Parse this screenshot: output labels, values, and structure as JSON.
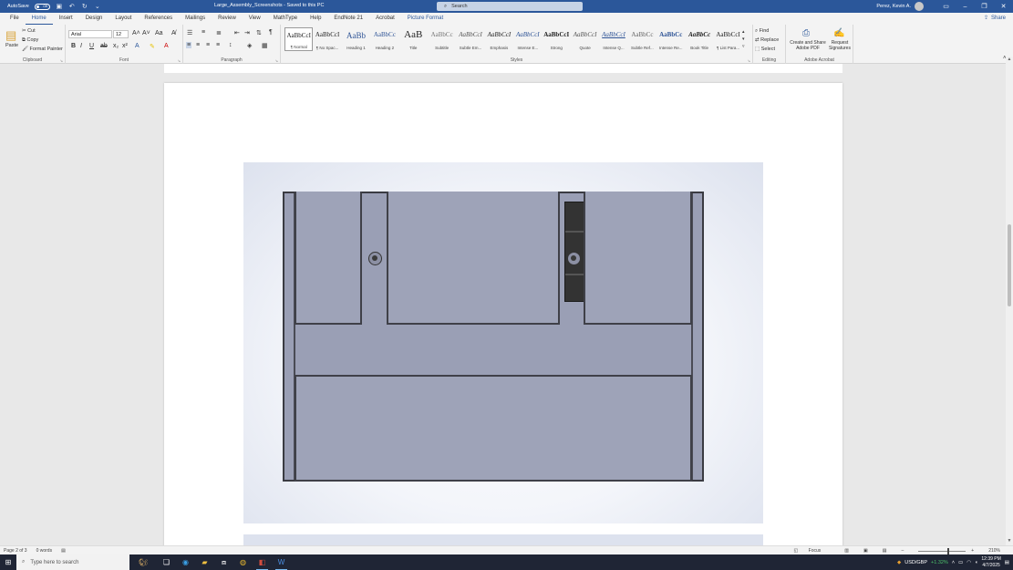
{
  "titlebar": {
    "autosave_label": "AutoSave",
    "autosave_state": "Off",
    "doc_title": "Large_Assembly_Screenshots  -  Saved to this PC",
    "search_placeholder": "Search",
    "user_name": "Perez, Kevin A."
  },
  "menu": {
    "tabs": [
      "File",
      "Home",
      "Insert",
      "Design",
      "Layout",
      "References",
      "Mailings",
      "Review",
      "View",
      "MathType",
      "Help",
      "EndNote 21",
      "Acrobat",
      "Picture Format"
    ],
    "active": "Home",
    "share_label": "Share"
  },
  "ribbon": {
    "clipboard": {
      "paste": "Paste",
      "cut": "Cut",
      "copy": "Copy",
      "format_painter": "Format Painter",
      "label": "Clipboard"
    },
    "font": {
      "name": "Arial",
      "size": "12",
      "label": "Font"
    },
    "paragraph": {
      "label": "Paragraph"
    },
    "styles": {
      "label": "Styles",
      "items": [
        {
          "sample": "AaBbCcI",
          "name": "¶ Normal"
        },
        {
          "sample": "AaBbCcI",
          "name": "¶ No Spac..."
        },
        {
          "sample": "AaBb",
          "name": "Heading 1"
        },
        {
          "sample": "AaBbCc",
          "name": "Heading 2"
        },
        {
          "sample": "AaB",
          "name": "Title"
        },
        {
          "sample": "AaBbCc",
          "name": "Subtitle"
        },
        {
          "sample": "AaBbCcI",
          "name": "Subtle Em..."
        },
        {
          "sample": "AaBbCcI",
          "name": "Emphasis"
        },
        {
          "sample": "AaBbCcI",
          "name": "Intense E..."
        },
        {
          "sample": "AaBbCcI",
          "name": "Strong"
        },
        {
          "sample": "AaBbCcI",
          "name": "Quote"
        },
        {
          "sample": "AaBbCcI",
          "name": "Intense Q..."
        },
        {
          "sample": "AaBbCc",
          "name": "Subtle Ref..."
        },
        {
          "sample": "AaBbCc",
          "name": "Intense Re..."
        },
        {
          "sample": "AaBbCc",
          "name": "Book Title"
        },
        {
          "sample": "AaBbCcI",
          "name": "¶ List Para..."
        }
      ]
    },
    "editing": {
      "find": "Find",
      "replace": "Replace",
      "select": "Select",
      "label": "Editing"
    },
    "acrobat": {
      "create_share": "Create and Share Adobe PDF",
      "request_sig": "Request Signatures",
      "label": "Adobe Acrobat"
    }
  },
  "statusbar": {
    "page": "Page 2 of 3",
    "words": "0 words",
    "focus": "Focus",
    "zoom": "210%"
  },
  "taskbar": {
    "search_placeholder": "Type here to search",
    "ticker": "USD/GBP",
    "ticker_change": "+1.32%",
    "time": "12:39 PM",
    "date": "4/7/2025"
  },
  "colors": {
    "brand": "#2b579a",
    "plate": "#9a9fb5",
    "taskbar": "#1f2535"
  }
}
